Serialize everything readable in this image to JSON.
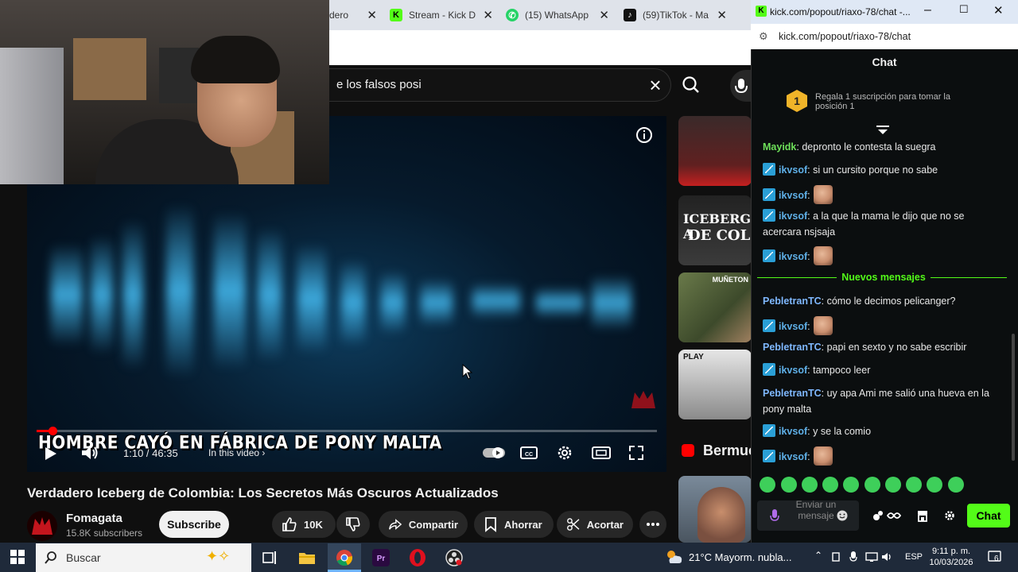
{
  "browser": {
    "tabs": [
      {
        "label": "dero",
        "icon": "page-icon"
      },
      {
        "label": "Stream - Kick D",
        "icon": "kick-icon"
      },
      {
        "label": "(15) WhatsApp",
        "icon": "whatsapp-icon"
      },
      {
        "label": "(59)TikTok - Ma",
        "icon": "tiktok-icon"
      }
    ],
    "search_query": "e los falsos posi"
  },
  "player": {
    "overlay_title": "HOMBRE CAYÓ EN FÁBRICA DE PONY MALTA",
    "time": "1:10 / 46:35",
    "in_this_video": "In this video",
    "progress_fraction": 0.025
  },
  "video": {
    "title": "Verdadero Iceberg de Colombia: Los Secretos Más Oscuros Actualizados",
    "channel": "Fomagata",
    "subscribers": "15.8K subscribers",
    "subscribe_label": "Subscribe",
    "likes": "10K",
    "share_label": "Compartir",
    "save_label": "Ahorrar",
    "clip_label": "Acortar"
  },
  "sidebar": {
    "thumb_texts": [
      "ICEBERG A",
      "DE COL",
      "MUÑETON",
      "PLAY"
    ],
    "section_label": "Bermuc"
  },
  "chat": {
    "window_title": "kick.com/popout/riaxo-78/chat -...",
    "url": "kick.com/popout/riaxo-78/chat",
    "header": "Chat",
    "gift_rank": "1",
    "gift_text": "Regala 1 suscripción para tomar la posición 1",
    "new_messages": "Nuevos mensajes",
    "messages": [
      {
        "user": "Mayidk",
        "text": "depronto le contesta la suegra"
      },
      {
        "user": "ikvsof",
        "text": "si un cursito porque no sabe"
      },
      {
        "user": "ikvsof",
        "text": ""
      },
      {
        "user": "ikvsof",
        "text": "a la que la mama le dijo que no se acercara nsjsaja"
      },
      {
        "user": "ikvsof",
        "text": ""
      },
      {
        "user": "PebletranTC",
        "text": "cómo le decimos pelicanger?"
      },
      {
        "user": "ikvsof",
        "text": ""
      },
      {
        "user": "PebletranTC",
        "text": "papi en sexto y no sabe escribir"
      },
      {
        "user": "ikvsof",
        "text": "tampoco leer"
      },
      {
        "user": "PebletranTC",
        "text": "uy apa Ami me salió una hueva en la pony malta"
      },
      {
        "user": "ikvsof",
        "text": "y se la comio"
      },
      {
        "user": "ikvsof",
        "text": ""
      }
    ],
    "input_placeholder": "Enviar un mensaje",
    "send_label": "Chat",
    "colors": {
      "kick_green": "#53fc18",
      "ikvsof": "#5fb0e8",
      "mayidk": "#6ee05a",
      "pebletran": "#7fb8ff"
    }
  },
  "taskbar": {
    "search_placeholder": "Buscar",
    "weather": "21°C  Mayorm. nubla...",
    "lang": "ESP",
    "time": "9:11 p. m.",
    "date": "10/03/2026",
    "notifications": "6"
  }
}
